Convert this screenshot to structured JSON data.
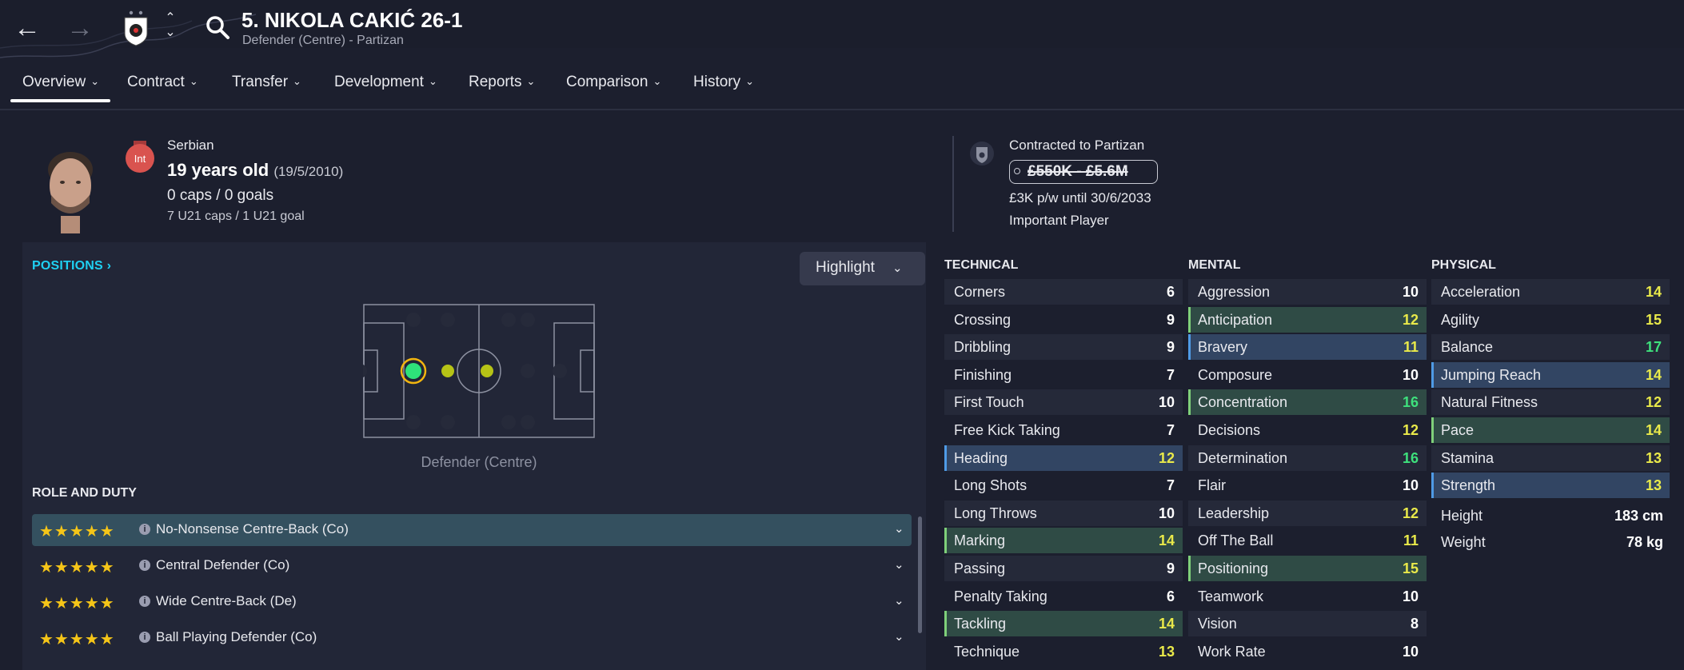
{
  "header": {
    "title": "5. NIKOLA CAKIĆ 26-1",
    "subtitle": "Defender (Centre) - Partizan"
  },
  "tabs": [
    {
      "label": "Overview"
    },
    {
      "label": "Contract"
    },
    {
      "label": "Transfer"
    },
    {
      "label": "Development"
    },
    {
      "label": "Reports"
    },
    {
      "label": "Comparison"
    },
    {
      "label": "History"
    }
  ],
  "profile": {
    "int_badge": "Int",
    "nationality": "Serbian",
    "age": "19 years old",
    "dob": "(19/5/2010)",
    "caps": "0 caps / 0 goals",
    "u21_caps": "7 U21 caps / 1 U21 goal",
    "contract_to": "Contracted to Partizan",
    "value": "£550K - £5.6M",
    "wage": "£3K p/w until 30/6/2033",
    "status": "Important Player"
  },
  "positions": {
    "label": "POSITIONS",
    "highlight_label": "Highlight",
    "caption": "Defender (Centre)"
  },
  "roles": {
    "title": "ROLE AND DUTY",
    "items": [
      {
        "label": "No-Nonsense Centre-Back (Co)",
        "stars": "★★★★★"
      },
      {
        "label": "Central Defender (Co)",
        "stars": "★★★★★"
      },
      {
        "label": "Wide Centre-Back (De)",
        "stars": "★★★★★"
      },
      {
        "label": "Ball Playing Defender (Co)",
        "stars": "★★★★★"
      }
    ]
  },
  "technical": {
    "title": "TECHNICAL",
    "items": [
      {
        "name": "Corners",
        "value": "6"
      },
      {
        "name": "Crossing",
        "value": "9"
      },
      {
        "name": "Dribbling",
        "value": "9"
      },
      {
        "name": "Finishing",
        "value": "7"
      },
      {
        "name": "First Touch",
        "value": "10"
      },
      {
        "name": "Free Kick Taking",
        "value": "7"
      },
      {
        "name": "Heading",
        "value": "12"
      },
      {
        "name": "Long Shots",
        "value": "7"
      },
      {
        "name": "Long Throws",
        "value": "10"
      },
      {
        "name": "Marking",
        "value": "14"
      },
      {
        "name": "Passing",
        "value": "9"
      },
      {
        "name": "Penalty Taking",
        "value": "6"
      },
      {
        "name": "Tackling",
        "value": "14"
      },
      {
        "name": "Technique",
        "value": "13"
      }
    ]
  },
  "mental": {
    "title": "MENTAL",
    "items": [
      {
        "name": "Aggression",
        "value": "10"
      },
      {
        "name": "Anticipation",
        "value": "12"
      },
      {
        "name": "Bravery",
        "value": "11"
      },
      {
        "name": "Composure",
        "value": "10"
      },
      {
        "name": "Concentration",
        "value": "16"
      },
      {
        "name": "Decisions",
        "value": "12"
      },
      {
        "name": "Determination",
        "value": "16"
      },
      {
        "name": "Flair",
        "value": "10"
      },
      {
        "name": "Leadership",
        "value": "12"
      },
      {
        "name": "Off The Ball",
        "value": "11"
      },
      {
        "name": "Positioning",
        "value": "15"
      },
      {
        "name": "Teamwork",
        "value": "10"
      },
      {
        "name": "Vision",
        "value": "8"
      },
      {
        "name": "Work Rate",
        "value": "10"
      }
    ]
  },
  "physical": {
    "title": "PHYSICAL",
    "items": [
      {
        "name": "Acceleration",
        "value": "14"
      },
      {
        "name": "Agility",
        "value": "15"
      },
      {
        "name": "Balance",
        "value": "17"
      },
      {
        "name": "Jumping Reach",
        "value": "14"
      },
      {
        "name": "Natural Fitness",
        "value": "12"
      },
      {
        "name": "Pace",
        "value": "14"
      },
      {
        "name": "Stamina",
        "value": "13"
      },
      {
        "name": "Strength",
        "value": "13"
      }
    ],
    "height_label": "Height",
    "height_value": "183 cm",
    "weight_label": "Weight",
    "weight_value": "78 kg"
  },
  "colors": {
    "positions_link": "#1fd0f2",
    "stars": "#f5c518",
    "attr_white": "#ffffff",
    "attr_yellow": "#e9e94a",
    "attr_green": "#3ee07c"
  }
}
